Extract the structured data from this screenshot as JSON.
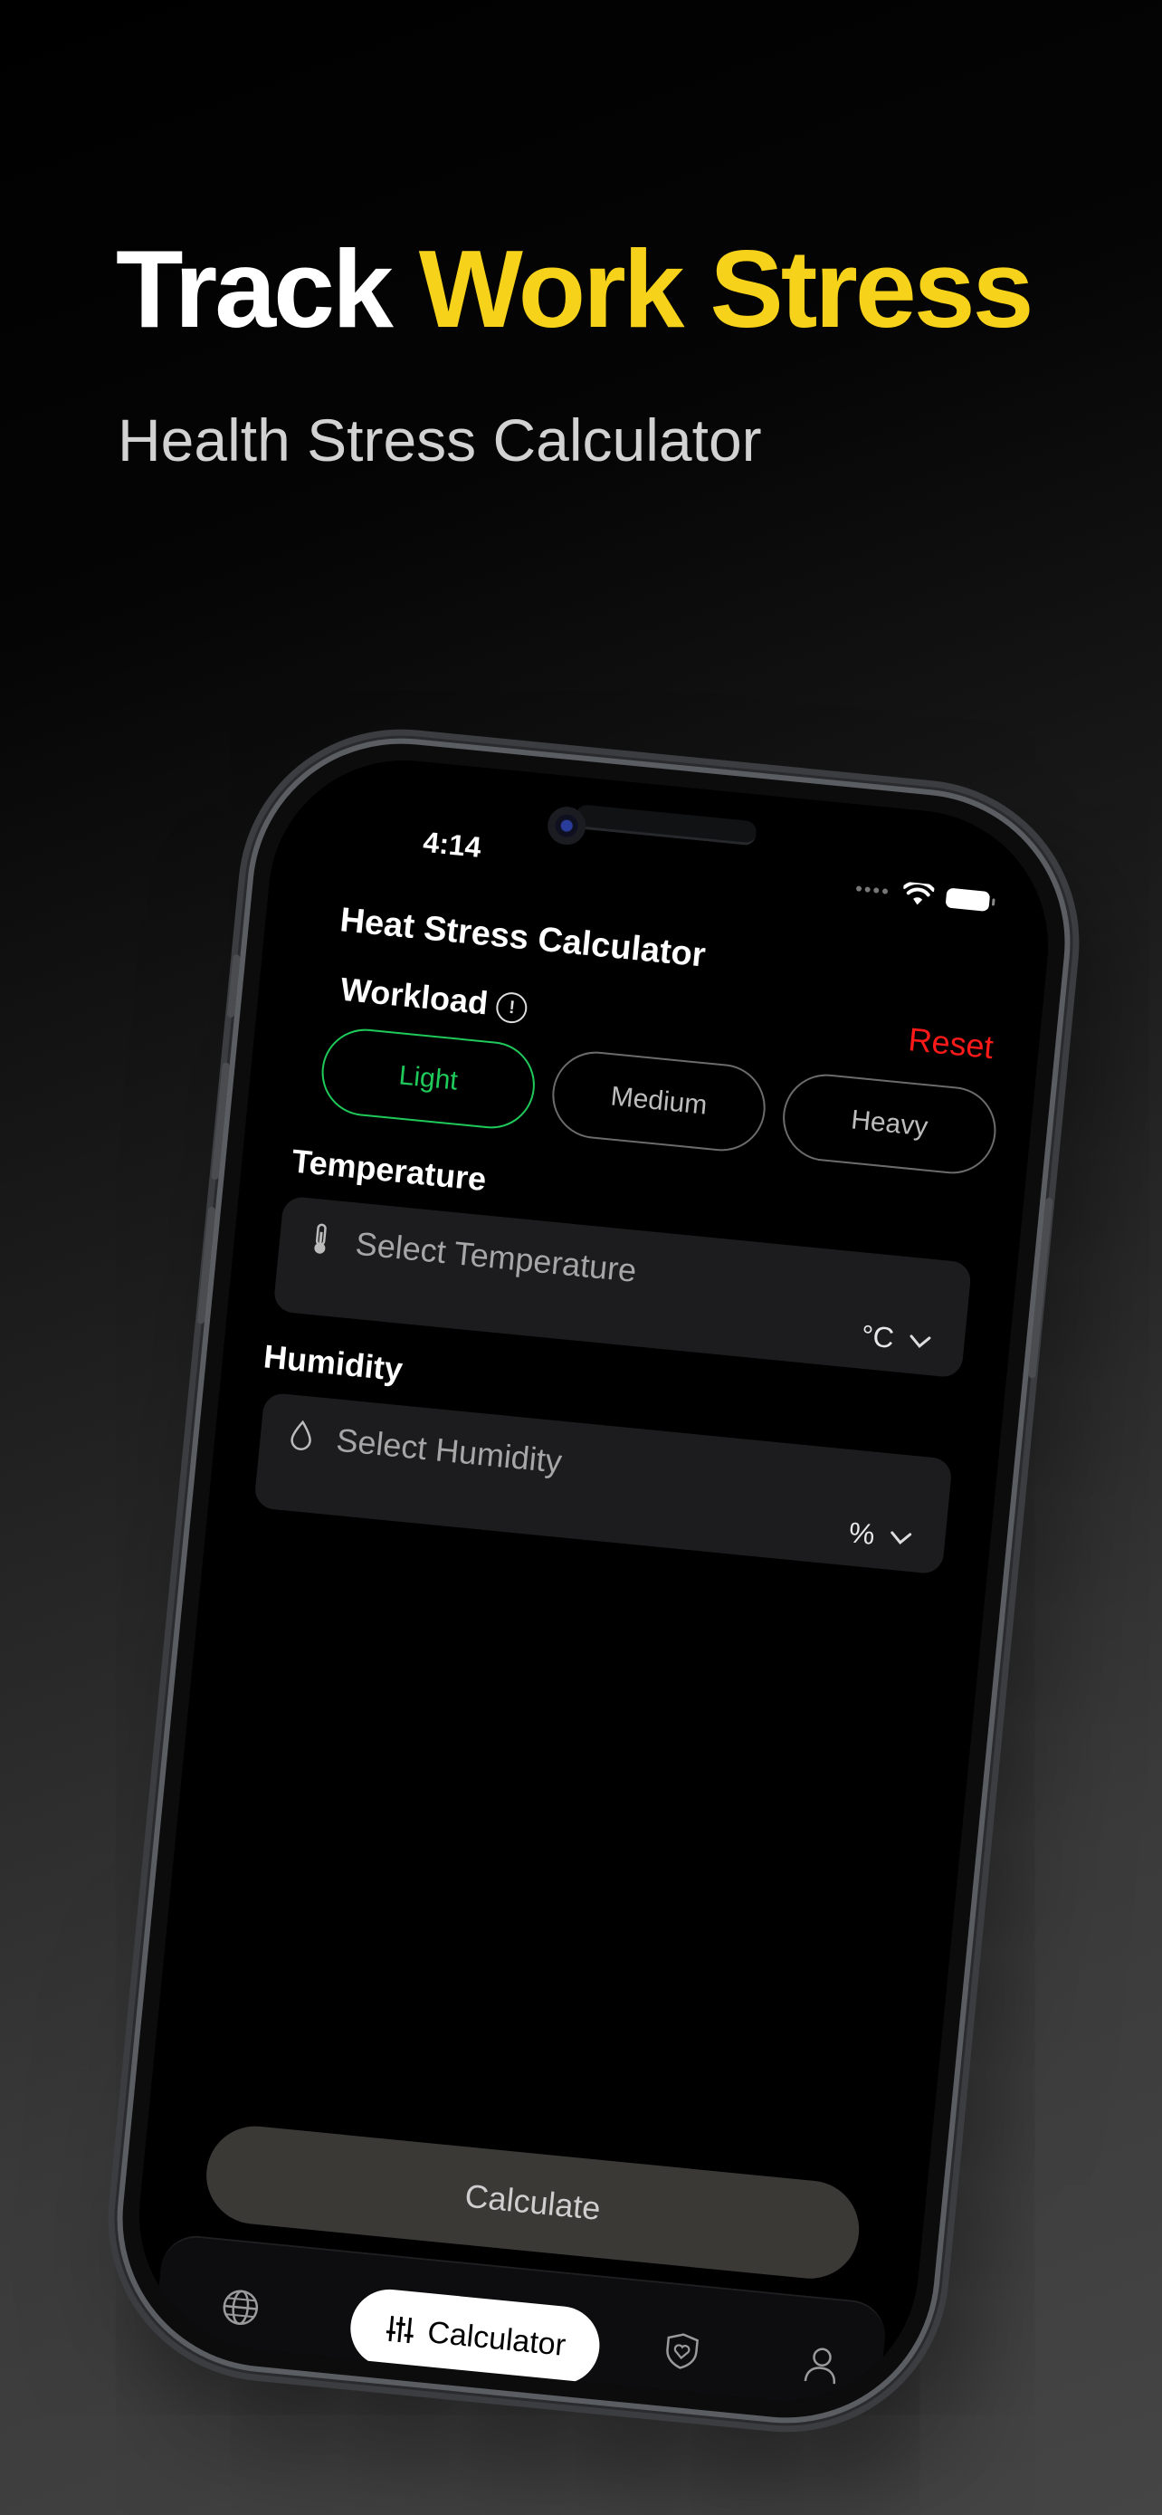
{
  "hero": {
    "title_part1": "Track",
    "title_part2": "Work Stress",
    "subtitle": "Health Stress Calculator",
    "accent_color": "#f7d21a"
  },
  "status_bar": {
    "time": "4:14",
    "icons": [
      "cellular-dots-icon",
      "wifi-icon",
      "battery-icon"
    ]
  },
  "app": {
    "title": "Heat Stress Calculator",
    "reset_label": "Reset",
    "reset_color": "#ff1a1a"
  },
  "workload": {
    "label": "Workload",
    "info_icon": "info-icon",
    "options": [
      "Light",
      "Medium",
      "Heavy"
    ],
    "selected": "Light",
    "selected_color": "#1fc95a"
  },
  "temperature": {
    "label": "Temperature",
    "placeholder": "Select Temperature",
    "unit": "°C",
    "icon": "thermometer-icon"
  },
  "humidity": {
    "label": "Humidity",
    "placeholder": "Select Humidity",
    "unit": "%",
    "icon": "droplet-icon"
  },
  "calculate_label": "Calculate",
  "tabs": [
    {
      "name": "globe",
      "icon": "globe-icon"
    },
    {
      "name": "calculator",
      "label": "Calculator",
      "icon": "sliders-icon",
      "active": true
    },
    {
      "name": "health",
      "icon": "heart-shield-icon"
    },
    {
      "name": "profile",
      "icon": "person-icon"
    }
  ]
}
